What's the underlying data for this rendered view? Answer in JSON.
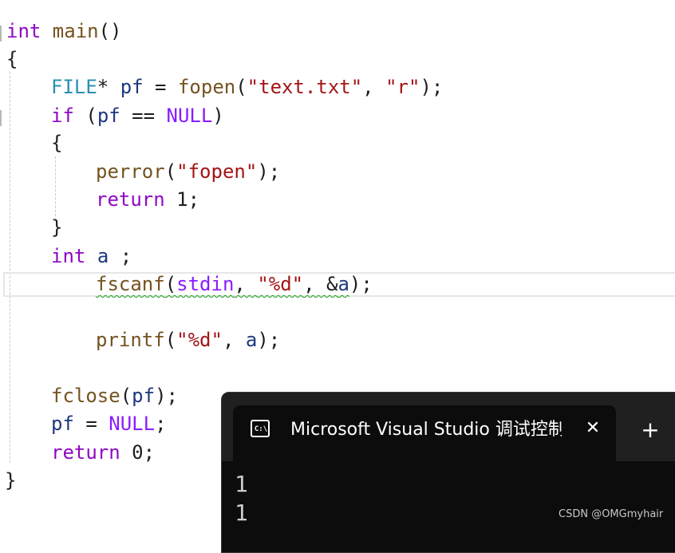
{
  "editor": {
    "lines": [
      [
        {
          "t": "int",
          "c": "kw"
        },
        {
          "t": " main",
          "c": "fn"
        },
        {
          "t": "()",
          "c": "pu"
        }
      ],
      [
        {
          "t": "{",
          "c": "pu"
        }
      ],
      [
        {
          "t": "FILE",
          "c": "ty"
        },
        {
          "t": "* ",
          "c": "pu"
        },
        {
          "t": "pf",
          "c": "id"
        },
        {
          "t": " = ",
          "c": "pu"
        },
        {
          "t": "fopen",
          "c": "fn"
        },
        {
          "t": "(",
          "c": "pu"
        },
        {
          "t": "\"text.txt\"",
          "c": "st"
        },
        {
          "t": ", ",
          "c": "pu"
        },
        {
          "t": "\"r\"",
          "c": "st"
        },
        {
          "t": ");",
          "c": "pu"
        }
      ],
      [
        {
          "t": "if",
          "c": "kw"
        },
        {
          "t": " (",
          "c": "pu"
        },
        {
          "t": "pf",
          "c": "id"
        },
        {
          "t": " == ",
          "c": "pu"
        },
        {
          "t": "NULL",
          "c": "mc"
        },
        {
          "t": ")",
          "c": "pu"
        }
      ],
      [
        {
          "t": "{",
          "c": "pu"
        }
      ],
      [
        {
          "t": "perror",
          "c": "fn"
        },
        {
          "t": "(",
          "c": "pu"
        },
        {
          "t": "\"fopen\"",
          "c": "st"
        },
        {
          "t": ");",
          "c": "pu"
        }
      ],
      [
        {
          "t": "return",
          "c": "kw"
        },
        {
          "t": " 1;",
          "c": "nu"
        }
      ],
      [
        {
          "t": "}",
          "c": "pu"
        }
      ],
      [
        {
          "t": "int",
          "c": "kw"
        },
        {
          "t": " ",
          "c": "pu"
        },
        {
          "t": "a",
          "c": "id"
        },
        {
          "t": " ;",
          "c": "pu"
        }
      ],
      [
        {
          "t": "fscanf",
          "c": "fn",
          "w": 1
        },
        {
          "t": "(",
          "c": "pu",
          "w": 1
        },
        {
          "t": "stdin",
          "c": "mc",
          "w": 1
        },
        {
          "t": ", ",
          "c": "pu",
          "w": 1
        },
        {
          "t": "\"%d\"",
          "c": "st",
          "w": 1
        },
        {
          "t": ", &",
          "c": "pu",
          "w": 1
        },
        {
          "t": "a",
          "c": "id",
          "w": 1
        },
        {
          "t": ");",
          "c": "pu"
        }
      ],
      [],
      [
        {
          "t": "printf",
          "c": "fn"
        },
        {
          "t": "(",
          "c": "pu"
        },
        {
          "t": "\"%d\"",
          "c": "st"
        },
        {
          "t": ", ",
          "c": "pu"
        },
        {
          "t": "a",
          "c": "id"
        },
        {
          "t": ");",
          "c": "pu"
        }
      ],
      [],
      [
        {
          "t": "fclose",
          "c": "fn"
        },
        {
          "t": "(",
          "c": "pu"
        },
        {
          "t": "pf",
          "c": "id"
        },
        {
          "t": ");",
          "c": "pu"
        }
      ],
      [
        {
          "t": "pf",
          "c": "id"
        },
        {
          "t": " = ",
          "c": "pu"
        },
        {
          "t": "NULL",
          "c": "mc"
        },
        {
          "t": ";",
          "c": "pu"
        }
      ],
      [
        {
          "t": "return",
          "c": "kw"
        },
        {
          "t": " 0;",
          "c": "nu"
        }
      ],
      [
        {
          "t": "}",
          "c": "pu"
        }
      ]
    ]
  },
  "console": {
    "tab_title": "Microsoft Visual Studio 调试控制台",
    "tab_icon_text": "C:\\",
    "close_glyph": "✕",
    "new_tab_glyph": "+",
    "output_lines": [
      "1",
      "1"
    ]
  },
  "watermark": "CSDN @OMGmyhair"
}
